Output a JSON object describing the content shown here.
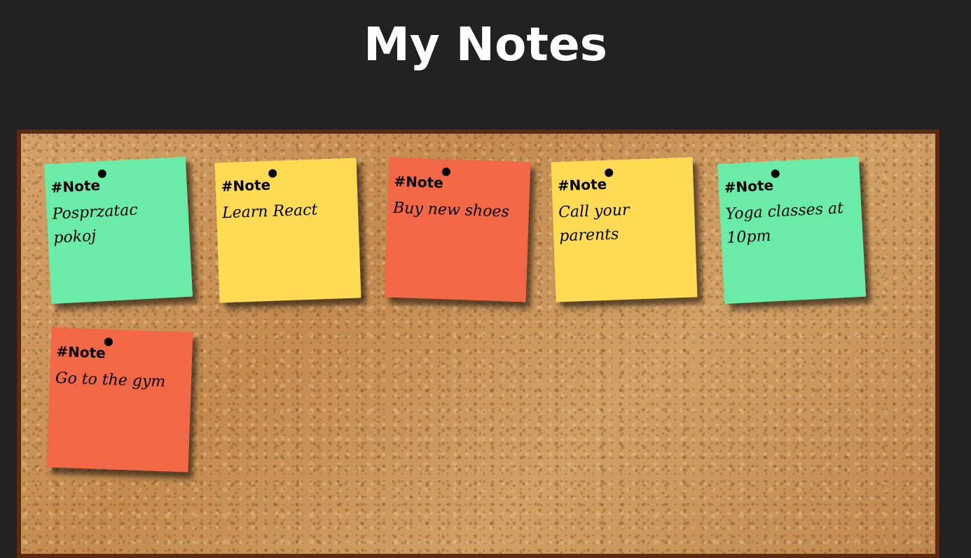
{
  "header": {
    "title": "My Notes"
  },
  "colors": {
    "background": "#212121",
    "board_frame": "#5a2a12",
    "cork": "#c9945a",
    "note_green": "#6aeba8",
    "note_yellow": "#ffdb54",
    "note_red": "#f26847"
  },
  "notes": [
    {
      "tag": "#Note",
      "text": "Posprzatac pokoj",
      "color": "green"
    },
    {
      "tag": "#Note",
      "text": "Learn React",
      "color": "yellow"
    },
    {
      "tag": "#Note",
      "text": "Buy new shoes",
      "color": "red"
    },
    {
      "tag": "#Note",
      "text": "Call your parents",
      "color": "yellow"
    },
    {
      "tag": "#Note",
      "text": "Yoga classes at 10pm",
      "color": "green"
    },
    {
      "tag": "#Note",
      "text": "Go to the gym",
      "color": "red"
    }
  ]
}
